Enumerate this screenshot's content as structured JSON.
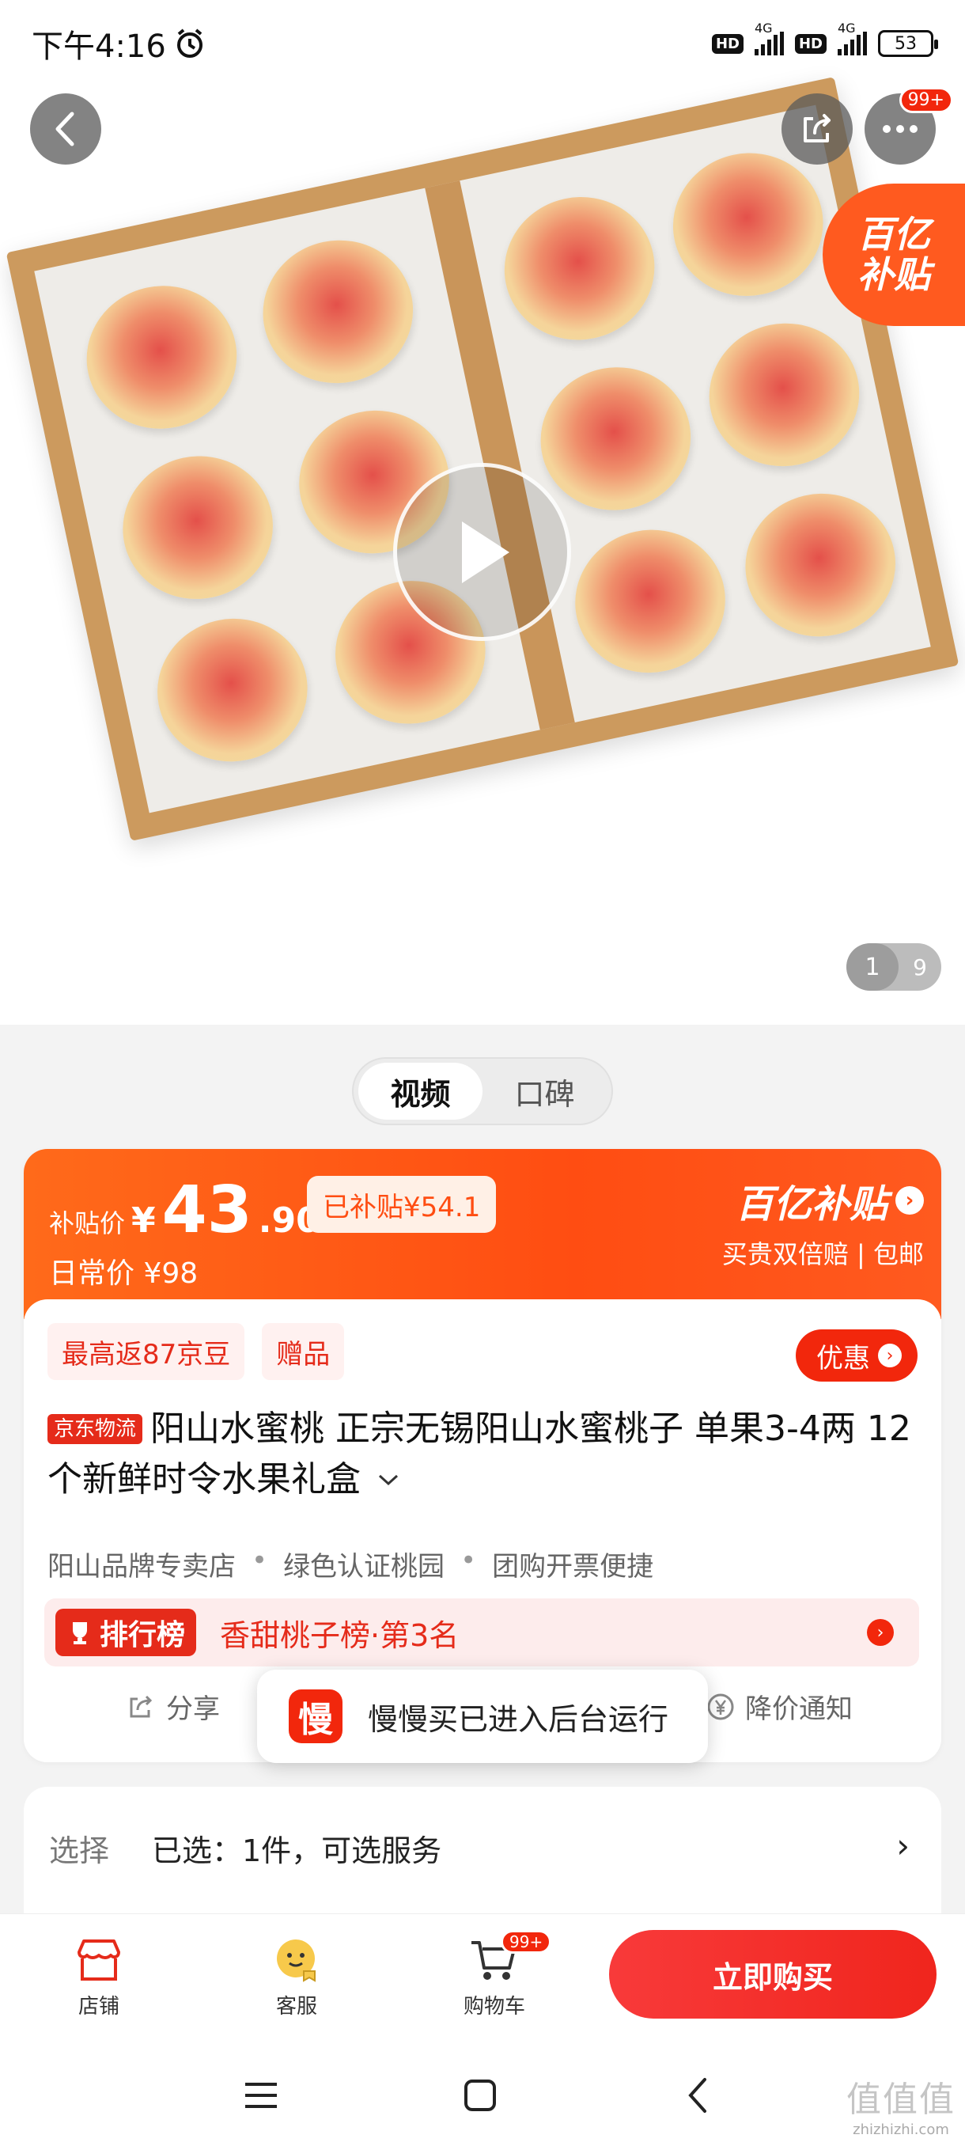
{
  "status_bar": {
    "time": "下午4:16",
    "network1": "4G",
    "network2": "4G",
    "hd": "HD",
    "battery": "53"
  },
  "hero": {
    "more_badge": "99+",
    "subsidy_corner_line1": "百亿",
    "subsidy_corner_line2": "补贴",
    "page_current": "1",
    "page_total": "9"
  },
  "media_tabs": [
    {
      "label": "视频",
      "active": true
    },
    {
      "label": "口碑",
      "active": false
    }
  ],
  "price": {
    "label": "补贴价",
    "currency": "¥",
    "integer": "43",
    "decimal": ".90",
    "subsidized": "已补贴¥54.1",
    "daily_price": "日常价 ¥98",
    "brand": "百亿补贴",
    "brand_sub": "买贵双倍赔 | 包邮"
  },
  "tags": [
    "最高返87京豆",
    "赠品"
  ],
  "discount_button": "优惠",
  "product": {
    "logistics_badge": "京东物流",
    "title": "阳山水蜜桃 正宗无锡阳山水蜜桃子 单果3-4两 12个新鲜时令水果礼盒",
    "features": [
      "阳山品牌专卖店",
      "绿色认证桃园",
      "团购开票便捷"
    ]
  },
  "ranking": {
    "badge": "排行榜",
    "text": "香甜桃子榜·第3名"
  },
  "actions": {
    "share": "分享",
    "price_notify": "降价通知"
  },
  "toast": {
    "icon_char": "慢",
    "text": "慢慢买已进入后台运行"
  },
  "selection": {
    "label": "选择",
    "value": "已选：1件，可选服务"
  },
  "bottom_bar": {
    "store": "店铺",
    "service": "客服",
    "cart": "购物车",
    "cart_badge": "99+",
    "buy_now": "立即购买"
  },
  "watermark": {
    "big": "值值值",
    "small": "zhizhizhi.com"
  },
  "colors": {
    "accent": "#f2270c",
    "subsidy_orange": "#ff5a1f"
  }
}
